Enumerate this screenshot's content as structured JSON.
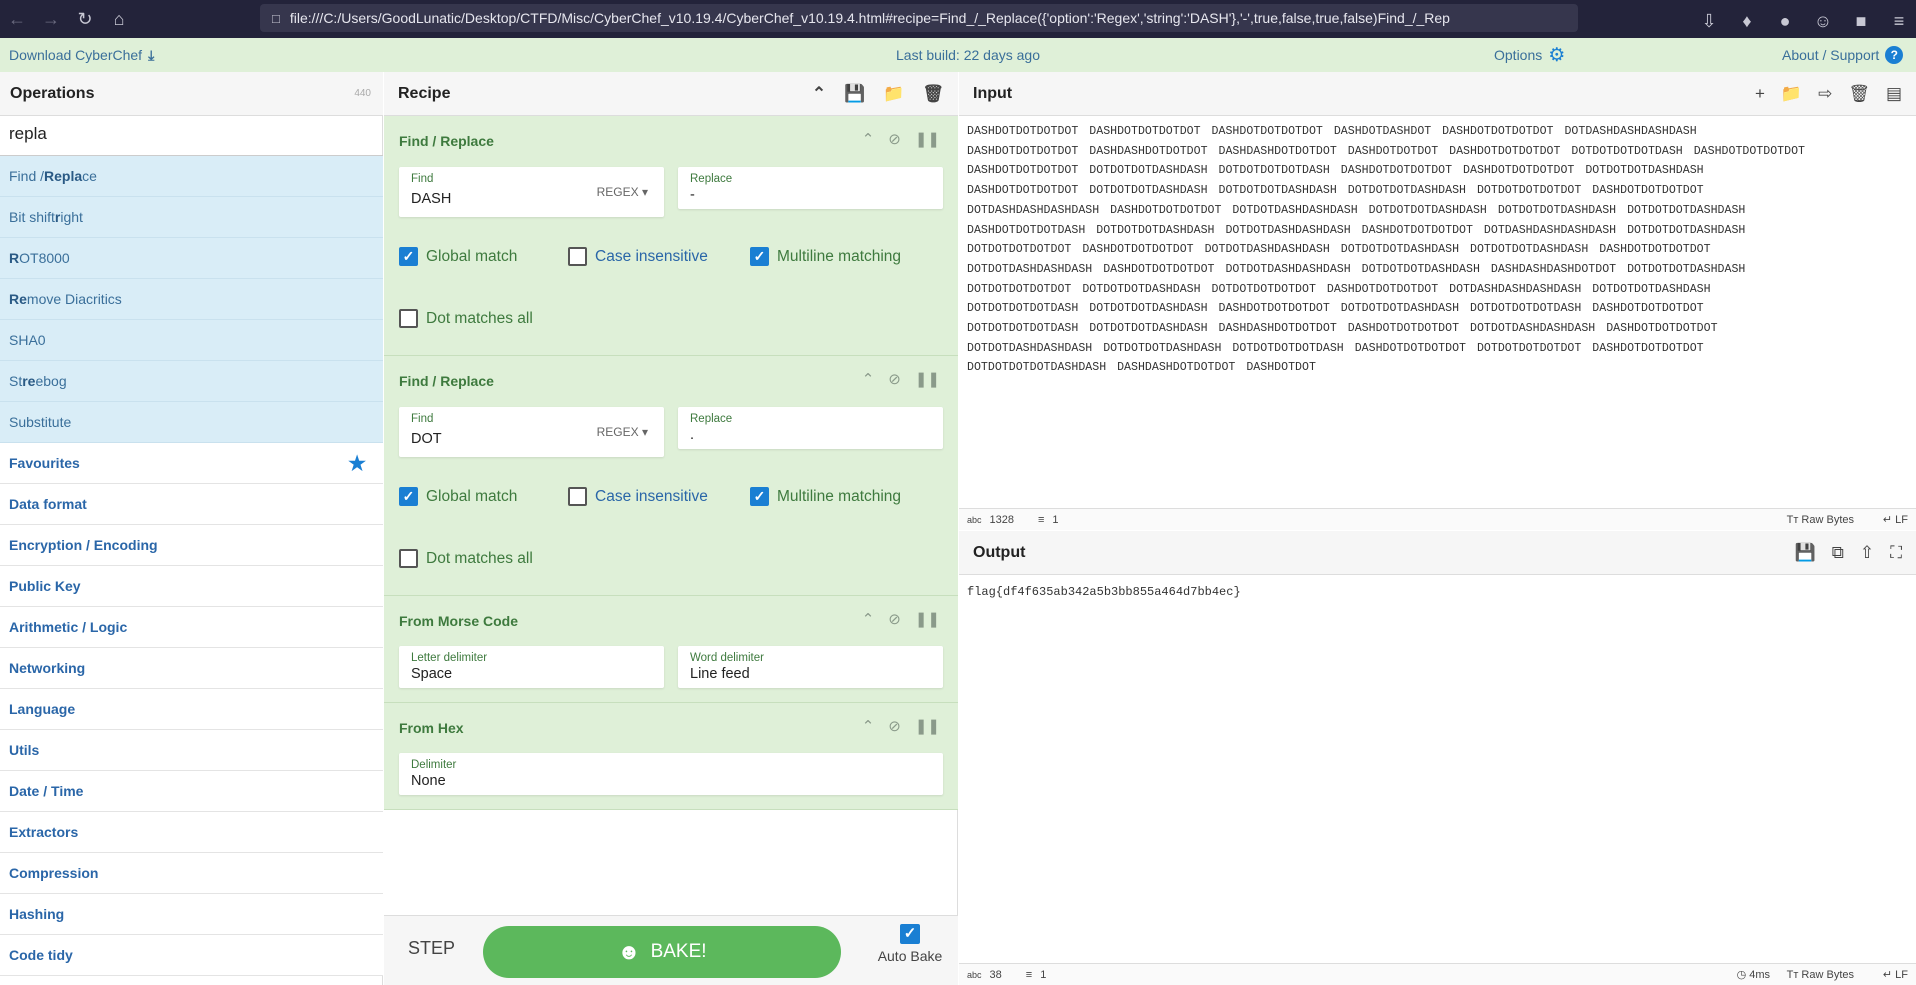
{
  "browser": {
    "url": "file:///C:/Users/GoodLunatic/Desktop/CTFD/Misc/CyberChef_v10.19.4/CyberChef_v10.19.4.html#recipe=Find_/_Replace({'option':'Regex','string':'DASH'},'-',true,false,true,false)Find_/_Rep"
  },
  "topbar": {
    "download": "Download CyberChef",
    "build": "Last build: 22 days ago",
    "options": "Options",
    "about": "About / Support"
  },
  "operations": {
    "title": "Operations",
    "count": "440",
    "search_value": "repla",
    "results": [
      {
        "pre": "Find / ",
        "hl": "Repla",
        "post": "ce"
      },
      {
        "pre": "Bit shift ",
        "hl": "r",
        "post": "ight"
      },
      {
        "pre": "",
        "hl": "R",
        "post": "OT8000"
      },
      {
        "pre": "",
        "hl": "Re",
        "post": "move Diacritics"
      },
      {
        "pre": "SHA0",
        "hl": "",
        "post": ""
      },
      {
        "pre": "St",
        "hl": "re",
        "post": "ebog"
      },
      {
        "pre": "Substitute",
        "hl": "",
        "post": ""
      }
    ],
    "categories": [
      "Favourites",
      "Data format",
      "Encryption / Encoding",
      "Public Key",
      "Arithmetic / Logic",
      "Networking",
      "Language",
      "Utils",
      "Date / Time",
      "Extractors",
      "Compression",
      "Hashing",
      "Code tidy"
    ]
  },
  "recipe": {
    "title": "Recipe",
    "op1": {
      "title": "Find / Replace",
      "find_label": "Find",
      "find": "DASH",
      "mode": "REGEX",
      "replace_label": "Replace",
      "replace": "-",
      "global": "Global match",
      "case": "Case insensitive",
      "multiline": "Multiline matching",
      "dotall": "Dot matches all"
    },
    "op2": {
      "title": "Find / Replace",
      "find_label": "Find",
      "find": "DOT",
      "mode": "REGEX",
      "replace_label": "Replace",
      "replace": ".",
      "global": "Global match",
      "case": "Case insensitive",
      "multiline": "Multiline matching",
      "dotall": "Dot matches all"
    },
    "op3": {
      "title": "From Morse Code",
      "letter_label": "Letter delimiter",
      "letter": "Space",
      "word_label": "Word delimiter",
      "word": "Line feed"
    },
    "op4": {
      "title": "From Hex",
      "delim_label": "Delimiter",
      "delim": "None"
    },
    "step": "STEP",
    "bake": "BAKE!",
    "autobake": "Auto Bake"
  },
  "input": {
    "title": "Input",
    "text": "DASHDOTDOTDOTDOT DASHDOTDOTDOTDOT DASHDOTDOTDOTDOT DASHDOTDASHDOT DASHDOTDOTDOTDOT DOTDASHDASHDASHDASH\nDASHDOTDOTDOTDOT DASHDASHDOTDOTDOT DASHDASHDOTDOTDOT DASHDOTDOTDOT DASHDOTDOTDOTDOT DOTDOTDOTDOTDASH DASHDOTDOTDOTDOT\nDASHDOTDOTDOTDOT DOTDOTDOTDASHDASH DOTDOTDOTDOTDASH DASHDOTDOTDOTDOT DASHDOTDOTDOTDOT DOTDOTDOTDASHDASH\nDASHDOTDOTDOTDOT DOTDOTDOTDASHDASH DOTDOTDOTDASHDASH DOTDOTDOTDASHDASH DOTDOTDOTDOTDOT DASHDOTDOTDOTDOT\nDOTDASHDASHDASHDASH DASHDOTDOTDOTDOT DOTDOTDASHDASHDASH DOTDOTDOTDASHDASH DOTDOTDOTDASHDASH DOTDOTDOTDASHDASH\nDASHDOTDOTDOTDASH DOTDOTDOTDASHDASH DOTDOTDASHDASHDASH DASHDOTDOTDOTDOT DOTDASHDASHDASHDASH DOTDOTDOTDASHDASH\nDOTDOTDOTDOTDOT DASHDOTDOTDOTDOT DOTDOTDASHDASHDASH DOTDOTDOTDASHDASH DOTDOTDOTDASHDASH DASHDOTDOTDOTDOT\nDOTDOTDASHDASHDASH DASHDOTDOTDOTDOT DOTDOTDASHDASHDASH DOTDOTDOTDASHDASH DASHDASHDASHDOTDOT DOTDOTDOTDASHDASH\nDOTDOTDOTDOTDOT DOTDOTDOTDASHDASH DOTDOTDOTDOTDOT DASHDOTDOTDOTDOT DOTDASHDASHDASHDASH DOTDOTDOTDASHDASH\nDOTDOTDOTDOTDASH DOTDOTDOTDASHDASH DASHDOTDOTDOTDOT DOTDOTDOTDASHDASH DOTDOTDOTDOTDASH DASHDOTDOTDOTDOT\nDOTDOTDOTDOTDASH DOTDOTDOTDASHDASH DASHDASHDOTDOTDOT DASHDOTDOTDOTDOT DOTDOTDASHDASHDASH DASHDOTDOTDOTDOT\nDOTDOTDASHDASHDASH DOTDOTDOTDASHDASH DOTDOTDOTDOTDASH DASHDOTDOTDOTDOT DOTDOTDOTDOTDOT DASHDOTDOTDOTDOT\nDOTDOTDOTDOTDASHDASH DASHDASHDOTDOTDOT DASHDOTDOT",
    "chars": "1328",
    "lines": "1",
    "raw": "Raw Bytes",
    "eol": "LF"
  },
  "output": {
    "title": "Output",
    "text": "flag{df4f635ab342a5b3bb855a464d7bb4ec}",
    "chars": "38",
    "lines": "1",
    "time": "4ms",
    "raw": "Raw Bytes",
    "eol": "LF"
  }
}
